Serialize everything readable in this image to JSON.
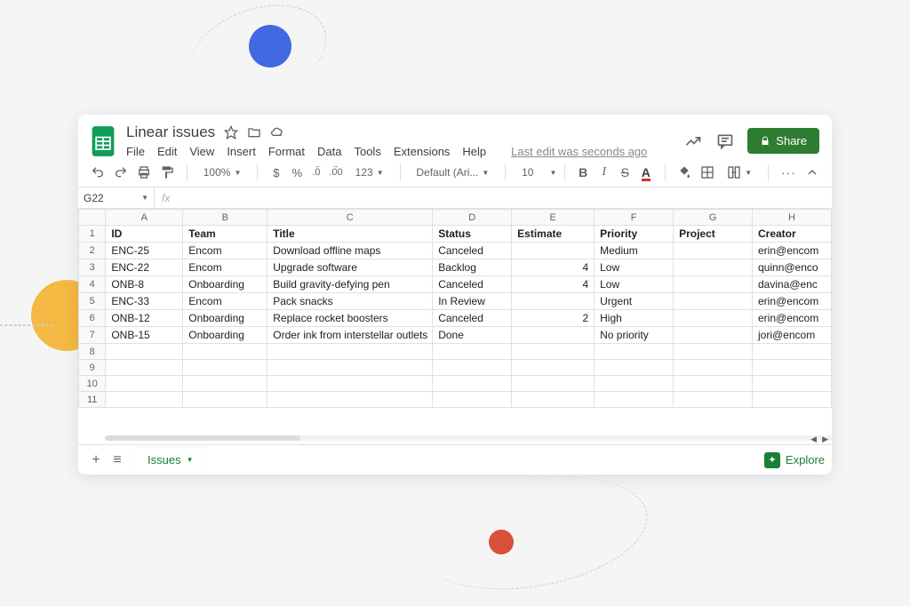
{
  "doc": {
    "title": "Linear issues",
    "last_edit": "Last edit was seconds ago"
  },
  "menus": [
    "File",
    "Edit",
    "View",
    "Insert",
    "Format",
    "Data",
    "Tools",
    "Extensions",
    "Help"
  ],
  "share_label": "Share",
  "toolbar": {
    "zoom": "100%",
    "currency": "$",
    "percent": "%",
    "dec_dec": ".0",
    "inc_dec": ".00",
    "num_format": "123",
    "font": "Default (Ari...",
    "font_size": "10",
    "more": "···"
  },
  "name_box": "G22",
  "fx_label": "fx",
  "columns": [
    "A",
    "B",
    "C",
    "D",
    "E",
    "F",
    "G",
    "H"
  ],
  "headers": [
    "ID",
    "Team",
    "Title",
    "Status",
    "Estimate",
    "Priority",
    "Project",
    "Creator"
  ],
  "rows": [
    {
      "n": 2,
      "id": "ENC-25",
      "team": "Encom",
      "title": "Download offline maps",
      "status": "Canceled",
      "estimate": "",
      "priority": "Medium",
      "project": "",
      "creator": "erin@encom"
    },
    {
      "n": 3,
      "id": "ENC-22",
      "team": "Encom",
      "title": "Upgrade software",
      "status": "Backlog",
      "estimate": "4",
      "priority": "Low",
      "project": "",
      "creator": "quinn@enco"
    },
    {
      "n": 4,
      "id": "ONB-8",
      "team": "Onboarding",
      "title": "Build gravity-defying pen",
      "status": "Canceled",
      "estimate": "4",
      "priority": "Low",
      "project": "",
      "creator": "davina@enc"
    },
    {
      "n": 5,
      "id": "ENC-33",
      "team": "Encom",
      "title": "Pack snacks",
      "status": "In Review",
      "estimate": "",
      "priority": "Urgent",
      "project": "",
      "creator": "erin@encom"
    },
    {
      "n": 6,
      "id": "ONB-12",
      "team": "Onboarding",
      "title": "Replace rocket boosters",
      "status": "Canceled",
      "estimate": "2",
      "priority": "High",
      "project": "",
      "creator": "erin@encom"
    },
    {
      "n": 7,
      "id": "ONB-15",
      "team": "Onboarding",
      "title": "Order ink from interstellar outlets",
      "status": "Done",
      "estimate": "",
      "priority": "No priority",
      "project": "",
      "creator": "jori@encom"
    }
  ],
  "empty_rows": [
    8,
    9,
    10,
    11
  ],
  "sheet_tab": "Issues",
  "explore_label": "Explore"
}
